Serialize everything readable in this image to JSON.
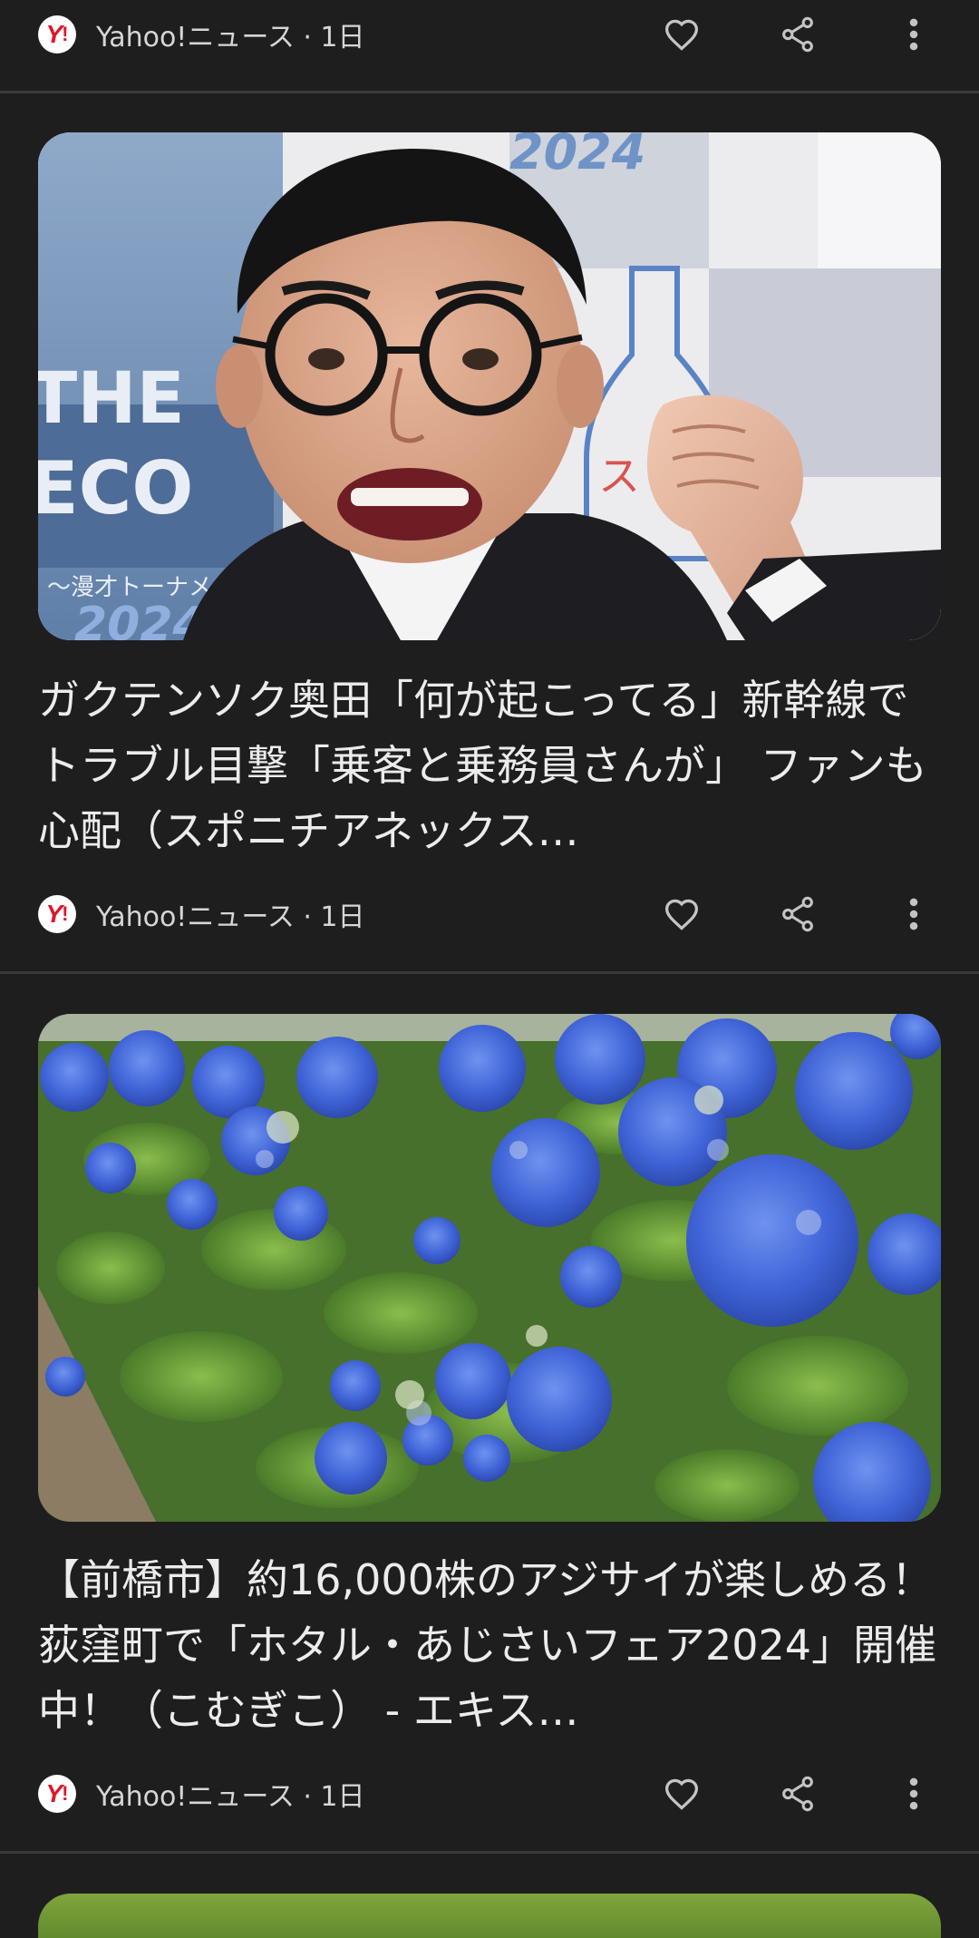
{
  "feed": {
    "top_item": {
      "source_meta": "Yahoo!ニュース · 1日"
    },
    "articles": [
      {
        "headline": "ガクテンソク奥田「何が起こってる」新幹線でトラブル目撃「乗客と乗務員さんが」 ファンも心配（スポニチアネックス…",
        "source_meta": "Yahoo!ニュース · 1日",
        "image_text": {
          "backdrop_top": "2024",
          "backdrop_left_1": "THE",
          "backdrop_left_2": "ECO",
          "backdrop_left_3": "〜漫才トーナメント〜",
          "backdrop_bottom": "2024",
          "bottle_text": "スドリ"
        }
      },
      {
        "headline": "【前橋市】約16,000株のアジサイが楽しめる！ 荻窪町で「ホタル・あじさいフェア2024」開催中！（こむぎこ） - エキス…",
        "source_meta": "Yahoo!ニュース · 1日"
      }
    ]
  },
  "icons": {
    "like": "heart-outline-icon",
    "share": "share-icon",
    "more": "more-vert-icon",
    "source_logo": "yahoo-logo-icon"
  },
  "colors": {
    "background": "#1e1e1f",
    "divider": "#3a3a3c",
    "text_primary": "#ececec",
    "text_secondary": "#d6d6d6",
    "icon": "#c4c4c4",
    "yahoo_red": "#e0162b"
  }
}
